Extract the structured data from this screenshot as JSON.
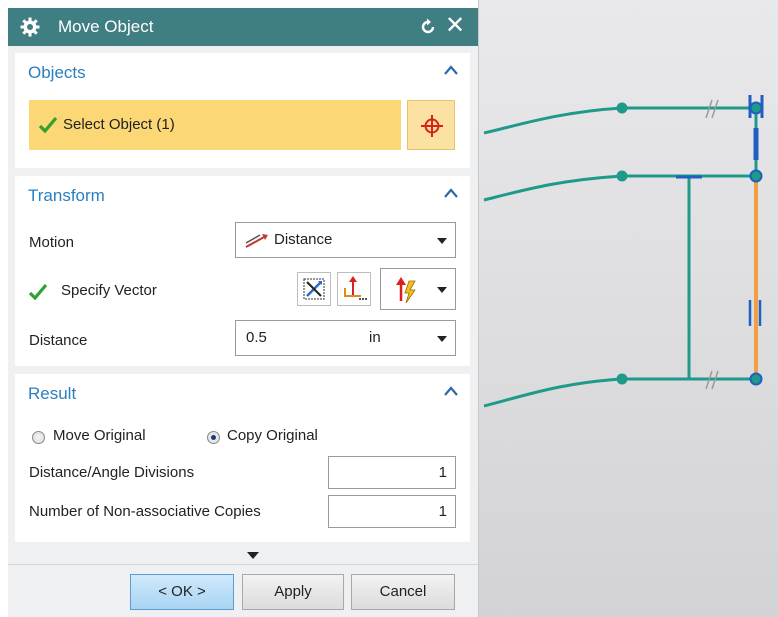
{
  "dialog": {
    "title": "Move Object",
    "icons": {
      "settings": "gear-icon",
      "reset": "reset-icon",
      "close": "close-icon"
    }
  },
  "objects_section": {
    "title": "Objects",
    "select_label": "Select Object (1)",
    "select_icon": "crosshair-icon"
  },
  "transform_section": {
    "title": "Transform",
    "motion_label": "Motion",
    "motion_value": "Distance",
    "vector_label": "Specify Vector",
    "distance_label": "Distance",
    "distance_value": "0.5",
    "distance_unit": "in"
  },
  "result_section": {
    "title": "Result",
    "move_original": "Move Original",
    "copy_original": "Copy Original",
    "selected": "Copy Original",
    "divisions_label": "Distance/Angle Divisions",
    "divisions_value": "1",
    "copies_label": "Number of Non-associative Copies",
    "copies_value": "1"
  },
  "buttons": {
    "ok": "< OK >",
    "apply": "Apply",
    "cancel": "Cancel"
  },
  "colors": {
    "titlebar": "#3f7f83",
    "section_title": "#2a7fc0",
    "selection_highlight": "#fbd775",
    "check_green": "#2fa12f",
    "geometry_green": "#1f9a8a",
    "geometry_orange": "#f0a040",
    "constraint_blue": "#1f5fbf"
  }
}
